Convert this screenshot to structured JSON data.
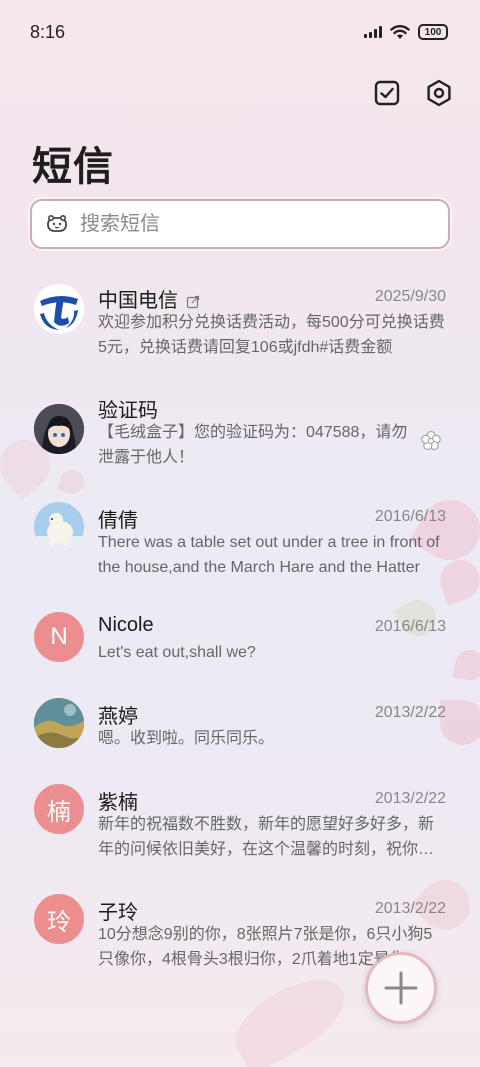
{
  "status_bar": {
    "time": "8:16",
    "battery": "100"
  },
  "header": {
    "title": "短信"
  },
  "search": {
    "placeholder": "搜索短信"
  },
  "colors": {
    "accent": "#ec8e8f",
    "search_border": "#cfa9b3",
    "telecom_blue": "#1d4fa8"
  },
  "conversations": [
    {
      "name": "中国电信",
      "date": "2025/9/30",
      "snippet": "欢迎参加积分兑换话费活动，每500分可兑换话费5元，兑换话费请回复106或jfdh#话费金额",
      "avatar": "telecom-logo"
    },
    {
      "name": "验证码",
      "date": "",
      "snippet": "【毛绒盒子】您的验证码为：047588，请勿泄露于他人！",
      "avatar": "anime-avatar"
    },
    {
      "name": "倩倩",
      "date": "2016/6/13",
      "snippet": "There was a table set out under a tree in front of the house,and the March Hare and the Hatter",
      "avatar": "polar-bear-avatar"
    },
    {
      "name": "Nicole",
      "date": "2016/6/13",
      "snippet": "Let's eat out,shall we?",
      "avatar_letter": "N"
    },
    {
      "name": "燕婷",
      "date": "2013/2/22",
      "snippet": "嗯。收到啦。同乐同乐。",
      "avatar": "landscape-avatar"
    },
    {
      "name": "紫楠",
      "date": "2013/2/22",
      "snippet": "新年的祝福数不胜数，新年的愿望好多好多，新年的问候依旧美好，在这个温馨的时刻，祝你新年快乐",
      "avatar_letter": "楠"
    },
    {
      "name": "子玲",
      "date": "2013/2/22",
      "snippet": "10分想念9别的你，8张照片7张是你，6只小狗5只像你，4根骨头3根归你，2爪着地1定是你",
      "avatar_letter": "玲"
    }
  ]
}
